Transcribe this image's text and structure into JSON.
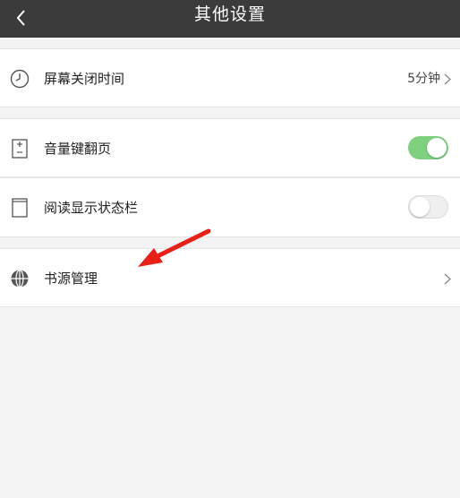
{
  "header": {
    "title": "其他设置",
    "back_icon": "back-arrow-icon"
  },
  "settings": {
    "screen_off": {
      "label": "屏幕关闭时间",
      "value": "5分钟",
      "icon": "clock-icon"
    },
    "volume_page_turn": {
      "label": "音量键翻页",
      "enabled": true,
      "icon": "volume-key-icon"
    },
    "show_status_bar": {
      "label": "阅读显示状态栏",
      "enabled": false,
      "icon": "status-bar-icon"
    },
    "book_source": {
      "label": "书源管理",
      "icon": "globe-icon"
    }
  },
  "colors": {
    "header_bg": "#3b3b3b",
    "toggle_on": "#7fd07f",
    "toggle_off": "#efefef",
    "annotation_arrow": "#e8201a"
  }
}
